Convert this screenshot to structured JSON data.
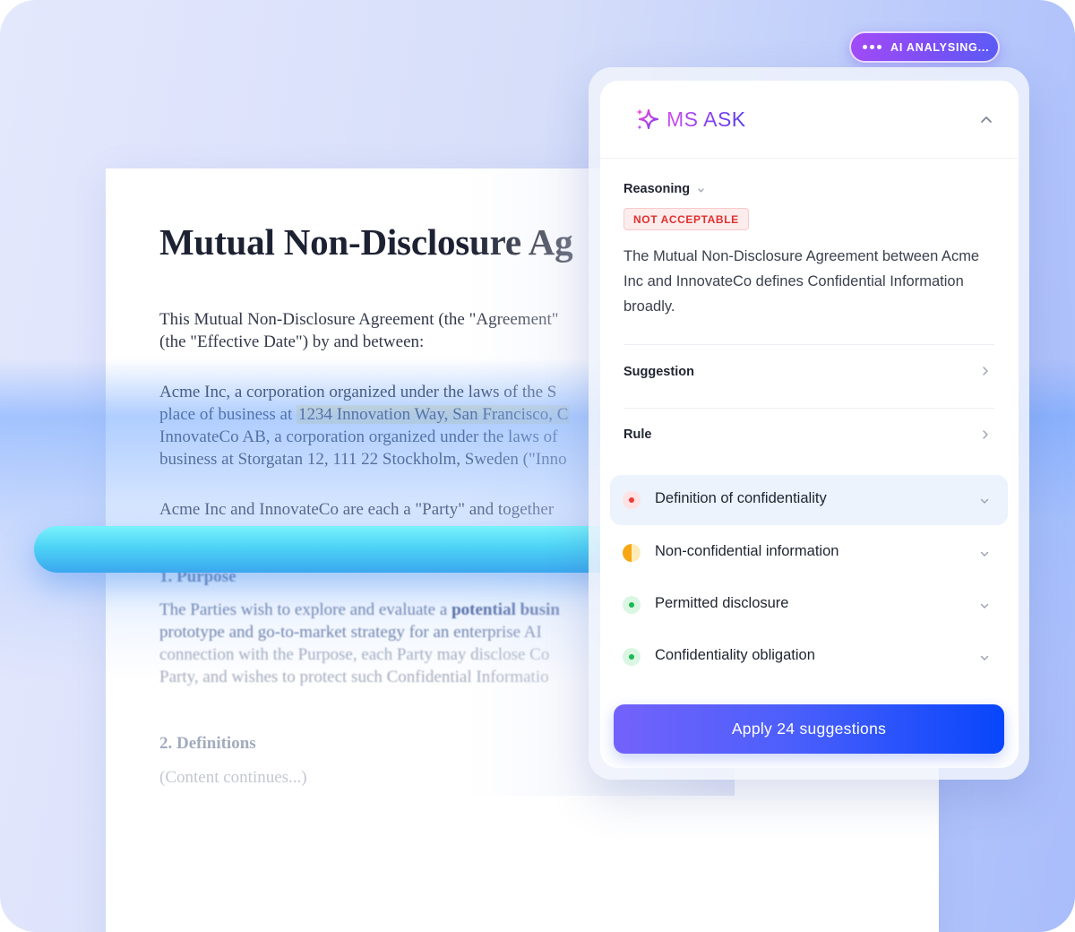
{
  "status_pill": {
    "label": "AI ANALYSING..."
  },
  "document": {
    "title": "Mutual Non-Disclosure Ag",
    "intro": [
      "This Mutual Non-Disclosure Agreement (the \"Agreement\"",
      "(the \"Effective Date\") by and between:"
    ],
    "parties": {
      "line1": "Acme Inc, a corporation organized under the laws of the S",
      "line2_prefix": "place of business at ",
      "line2_highlight": "1234 Innovation Way, San Francisco, C",
      "line3": "InnovateCo AB, a corporation organized under the laws of",
      "line4": "business at Storgatan 12, 111 22 Stockholm, Sweden (\"Inno"
    },
    "party_line": "Acme Inc and InnovateCo are each a \"Party\" and together",
    "purpose_heading": "1. Purpose",
    "purpose": {
      "line1_prefix": "The Parties wish to explore and evaluate a ",
      "line1_bold": "potential busin",
      "line2": "prototype and go-to-market strategy  for an enterprise AI",
      "line3": "connection with the Purpose, each Party may disclose Co",
      "line4": "Party, and wishes to protect such Confidential Informatio"
    },
    "definitions_heading": "2. Definitions",
    "continues": "(Content continues...)"
  },
  "panel": {
    "brand": "MS ASK",
    "reasoning_label": "Reasoning",
    "verdict_badge": "NOT ACCEPTABLE",
    "reasoning_text": "The Mutual Non-Disclosure Agreement between Acme Inc and InnovateCo defines Confidential Information broadly.",
    "suggestion_label": "Suggestion",
    "rule_label": "Rule",
    "rules": [
      {
        "label": "Definition of confidentiality",
        "status": "red",
        "active": true
      },
      {
        "label": "Non-confidential information",
        "status": "partial",
        "active": false
      },
      {
        "label": "Permitted disclosure",
        "status": "green",
        "active": false
      },
      {
        "label": "Confidentiality obligation",
        "status": "green",
        "active": false
      }
    ],
    "apply_button": "Apply 24 suggestions"
  },
  "colors": {
    "accent": "#0846fb",
    "brand_gradient_start": "#d24bf0",
    "status_red": "#ef3b3b",
    "status_orange": "#f6a712",
    "status_green": "#1bb954",
    "badge_red": "#e0302f"
  },
  "icons": [
    "sparkle-icon",
    "chevron-up-icon",
    "chevron-down-icon",
    "chevron-right-icon",
    "dots-icon"
  ]
}
